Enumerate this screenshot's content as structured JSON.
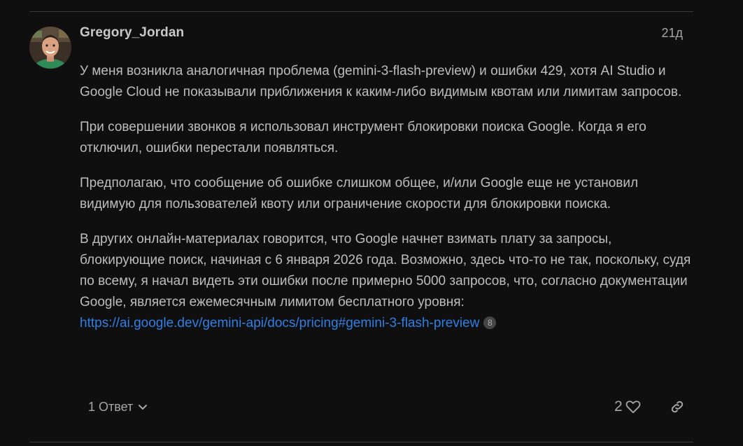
{
  "post": {
    "username": "Gregory_Jordan",
    "date": "21д",
    "paragraphs": [
      "У меня возникла аналогичная проблема (gemini-3-flash-preview) и ошибки 429, хотя AI Studio и Google Cloud не показывали приближения к каким-либо видимым квотам или лимитам запросов.",
      "При совершении звонков я использовал инструмент блокировки поиска Google. Когда я его отключил, ошибки перестали появляться.",
      "Предполагаю, что сообщение об ошибке слишком общее, и/или Google еще не установил видимую для пользователей квоту или ограничение скорости для блокировки поиска.",
      "В других онлайн-материалах говорится, что Google начнет взимать плату за запросы, блокирующие поиск, начиная с 6 января 2026 года. Возможно, здесь что-то не так, поскольку, судя по всему, я начал видеть эти ошибки после примерно 5000 запросов, что, согласно документации Google, является ежемесячным лимитом бесплатного уровня:"
    ],
    "link": {
      "text": "https://ai.google.dev/gemini-api/docs/pricing#gemini-3-flash-preview",
      "click_count": "8"
    }
  },
  "actions": {
    "replies_label": "1 Ответ",
    "like_count": "2"
  },
  "colors": {
    "background": "#0f0f0f",
    "text": "#bdbdbd",
    "link": "#2f7fe6",
    "muted": "#a6a6a6"
  }
}
